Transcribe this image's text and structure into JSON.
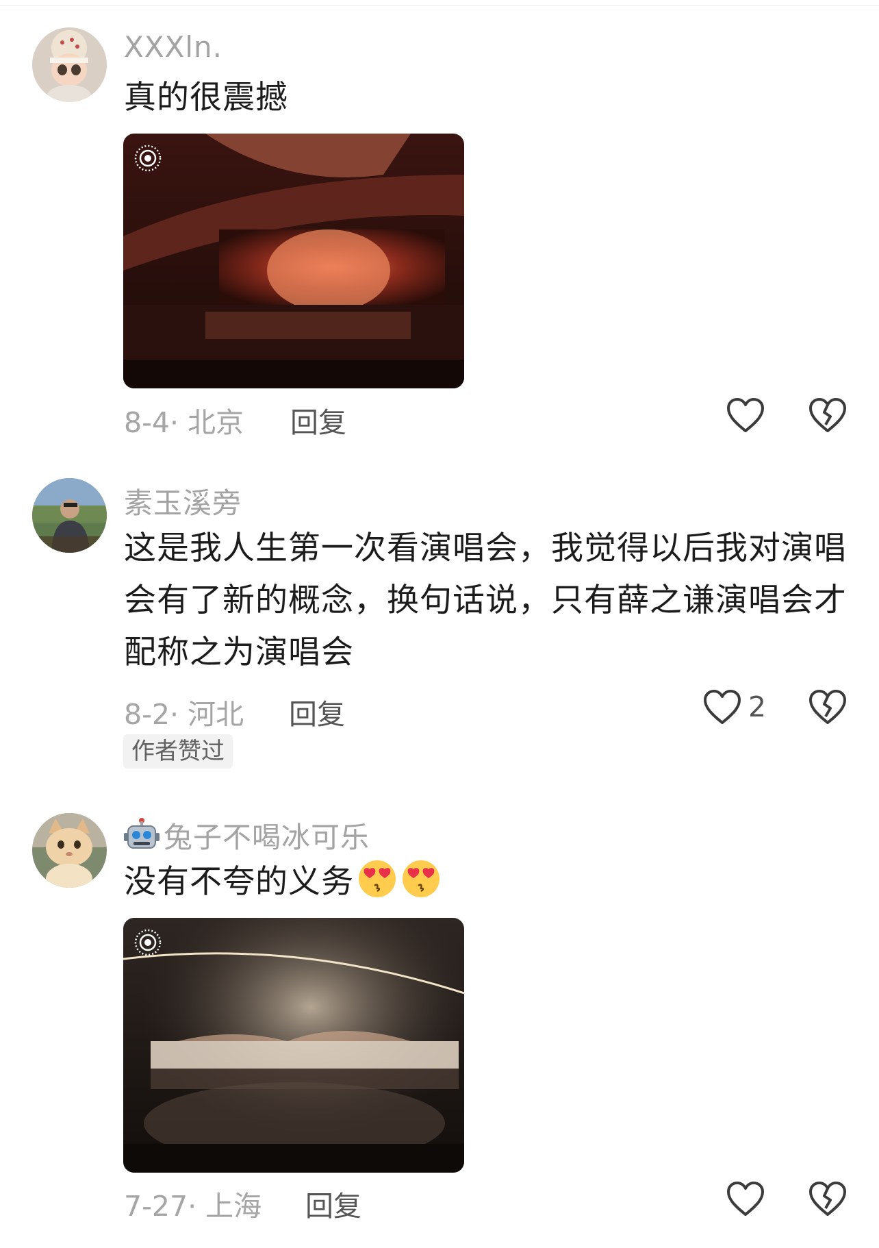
{
  "comments": [
    {
      "username": "XXXln.",
      "text": "真的很震撼",
      "date": "8-4",
      "location": "北京",
      "reply_label": "回复",
      "likes": "",
      "avatar_icon": "avatar-doll-icon"
    },
    {
      "username": "素玉溪旁",
      "text": "这是我人生第一次看演唱会，我觉得以后我对演唱会有了新的概念，换句话说，只有薛之谦演唱会才配称之为演唱会",
      "date": "8-2",
      "location": "河北",
      "reply_label": "回复",
      "likes": "2",
      "badge": "作者赞过",
      "avatar_icon": "avatar-man-icon"
    },
    {
      "username": "兔子不喝冰可乐",
      "text": "没有不夸的义务",
      "date": "7-27",
      "location": "上海",
      "reply_label": "回复",
      "likes": "",
      "avatar_icon": "avatar-cat-icon"
    }
  ],
  "colors": {
    "muted": "#a5a5a5",
    "text": "#1c1c1c",
    "badge_bg": "#f2f2f2"
  },
  "icons": [
    "heart-icon",
    "broken-heart-icon",
    "live-photo-icon",
    "robot-emoji",
    "heart-eyes-emoji"
  ]
}
